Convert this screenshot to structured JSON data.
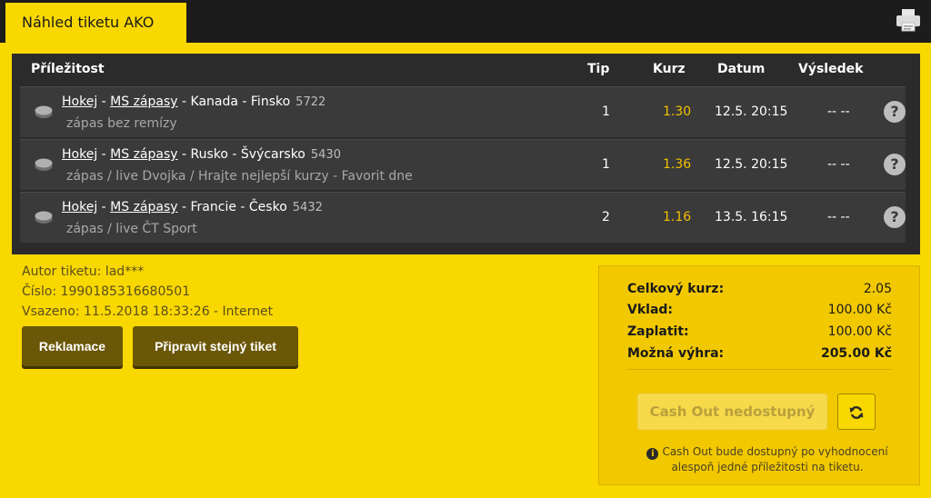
{
  "header": {
    "tab_title": "Náhled tiketu AKO"
  },
  "table": {
    "columns": {
      "event": "Příležitost",
      "tip": "Tip",
      "odds": "Kurz",
      "date": "Datum",
      "result": "Výsledek"
    },
    "rows": [
      {
        "sport": "Hokej",
        "league": "MS zápasy",
        "match": "Kanada - Finsko",
        "code": "5722",
        "market": "zápas bez remízy",
        "tip": "1",
        "odds": "1.30",
        "date": "12.5. 20:15",
        "result": "-- --"
      },
      {
        "sport": "Hokej",
        "league": "MS zápasy",
        "match": "Rusko - Švýcarsko",
        "code": "5430",
        "market": "zápas / live Dvojka / Hrajte nejlepší kurzy - Favorit dne",
        "tip": "1",
        "odds": "1.36",
        "date": "12.5. 20:15",
        "result": "-- --"
      },
      {
        "sport": "Hokej",
        "league": "MS zápasy",
        "match": "Francie - Česko",
        "code": "5432",
        "market": "zápas / live ČT Sport",
        "tip": "2",
        "odds": "1.16",
        "date": "13.5. 16:15",
        "result": "-- --"
      }
    ],
    "separator": " - ",
    "help_glyph": "?"
  },
  "ticket_info": {
    "author": "Autor tiketu: lad***",
    "number": "Číslo: 1990185316680501",
    "placed": "Vsazeno: 11.5.2018 18:33:26 - Internet"
  },
  "buttons": {
    "complaint": "Reklamace",
    "prepare_same": "Připravit stejný tiket"
  },
  "summary": {
    "total_odds_label": "Celkový kurz:",
    "total_odds": "2.05",
    "stake_label": "Vklad:",
    "stake": "100.00 Kč",
    "pay_label": "Zaplatit:",
    "pay": "100.00 Kč",
    "win_label": "Možná výhra:",
    "win": "205.00 Kč",
    "cashout_label": "Cash Out nedostupný",
    "info_glyph": "i",
    "note": "Cash Out bude dostupný po vyhodnocení alespoň jedné příležitosti na tiketu."
  },
  "colors": {
    "brand_yellow": "#f9d800",
    "panel_dark": "#2b2b2b",
    "odds_color": "#f2c200",
    "button_brown": "#6b5708"
  },
  "icons": {
    "print": "printer-icon",
    "puck": "hockey-puck-icon",
    "help": "question-circle-icon",
    "refresh": "refresh-icon",
    "info": "info-icon"
  }
}
